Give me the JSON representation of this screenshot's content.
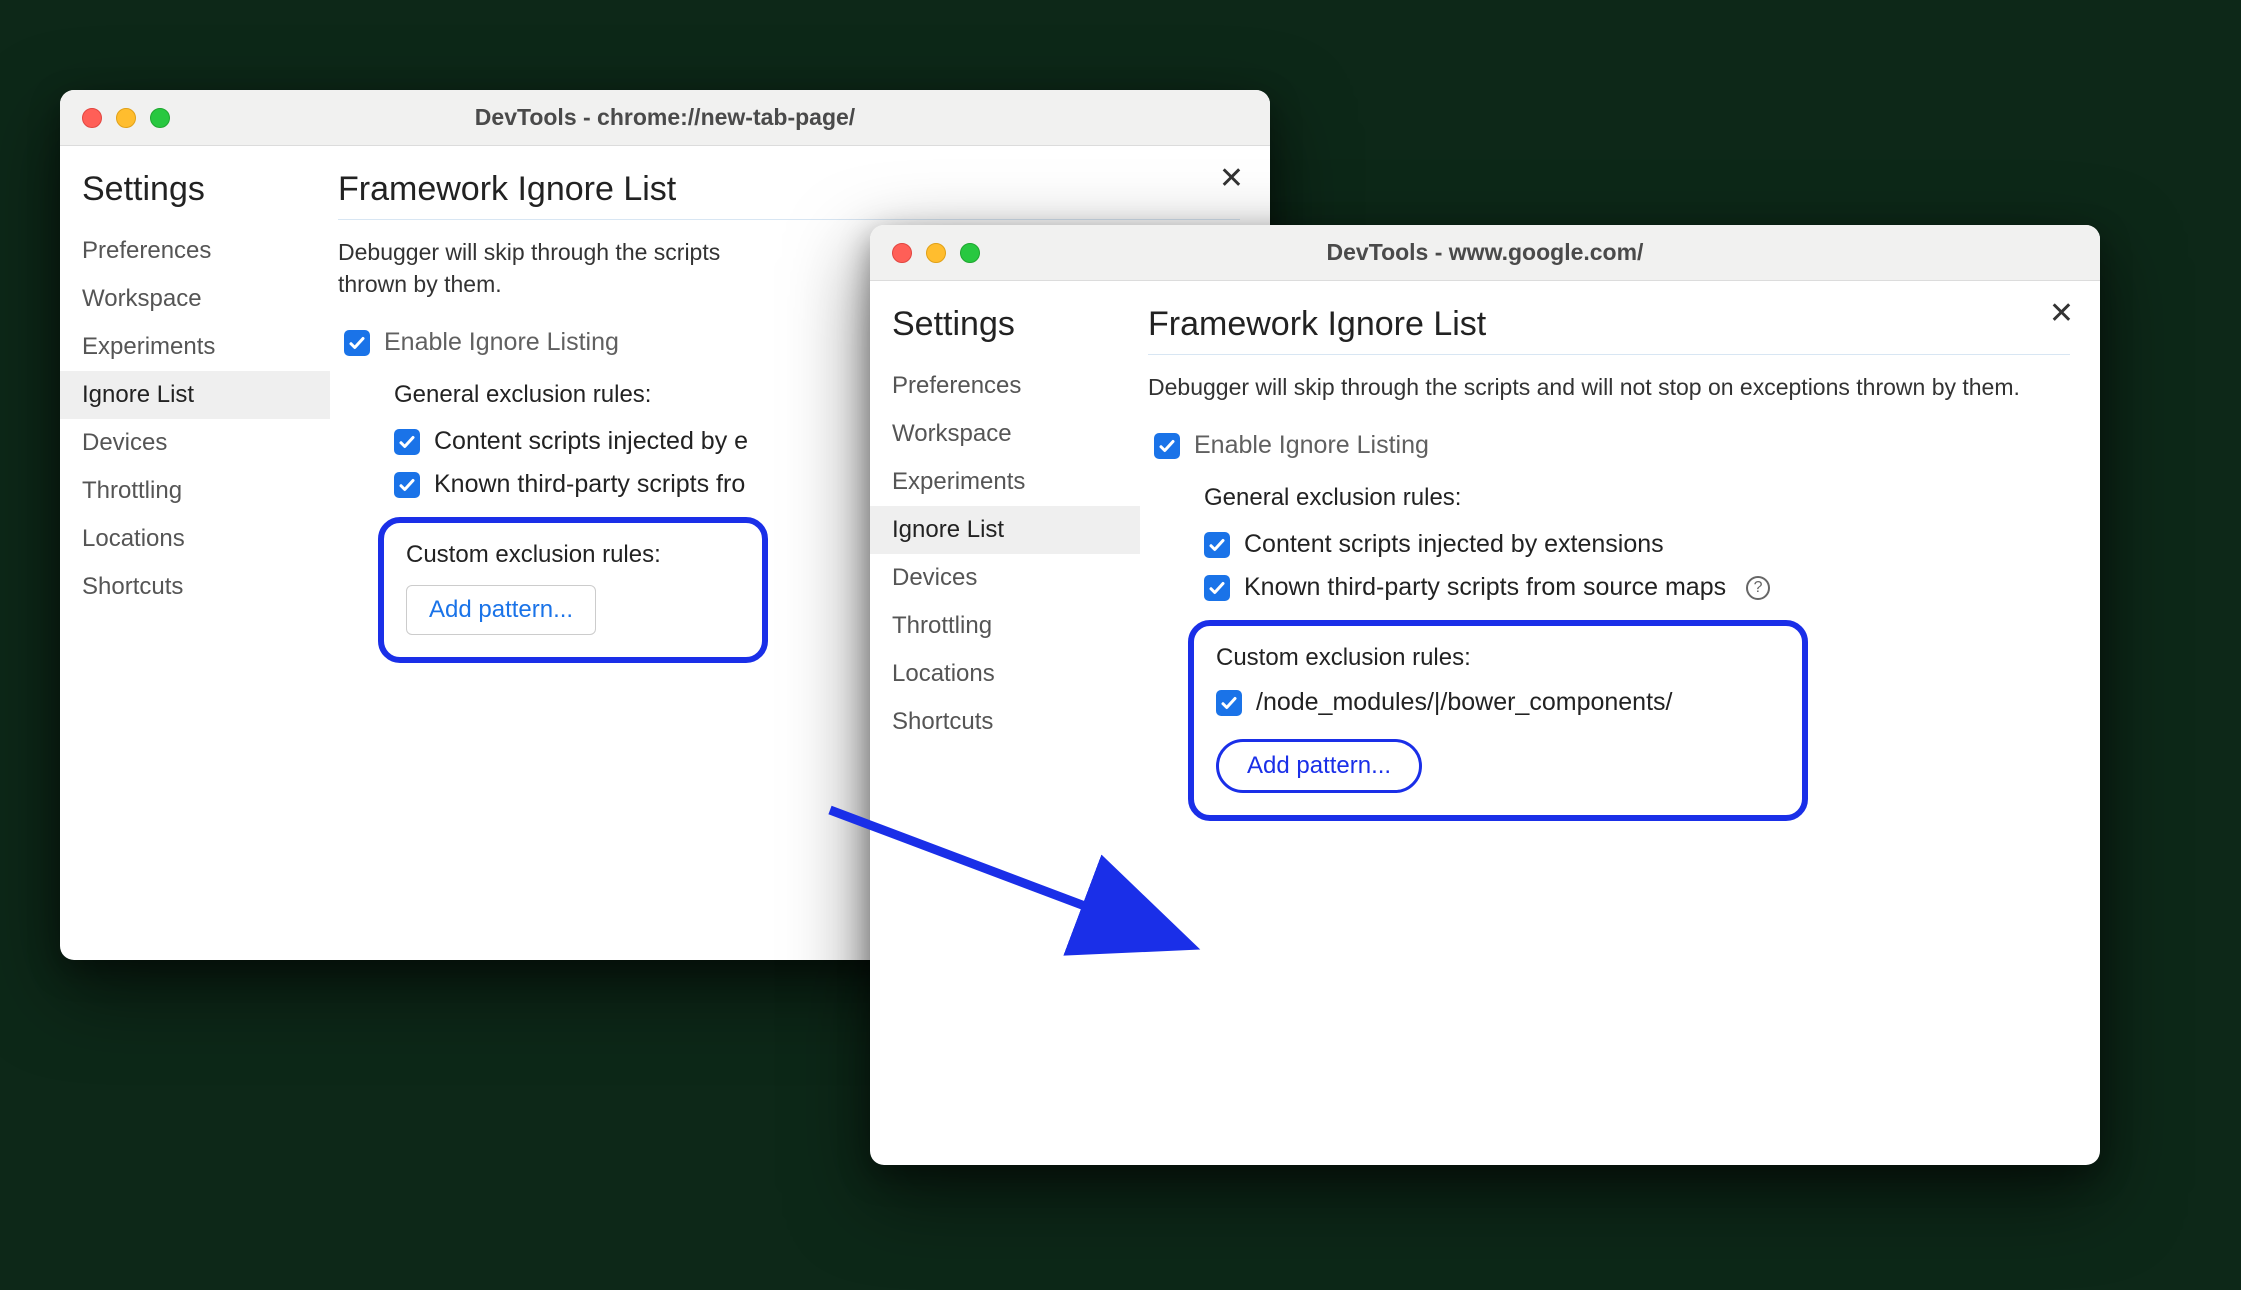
{
  "windows": {
    "left": {
      "title": "DevTools - chrome://new-tab-page/",
      "settings_title": "Settings",
      "nav": [
        "Preferences",
        "Workspace",
        "Experiments",
        "Ignore List",
        "Devices",
        "Throttling",
        "Locations",
        "Shortcuts"
      ],
      "nav_active_index": 3,
      "panel_title": "Framework Ignore List",
      "panel_desc_visible": "Debugger will skip through the scripts\nthrown by them.",
      "enable_label": "Enable Ignore Listing",
      "general_rules_head": "General exclusion rules:",
      "rule_content_visible": "Content scripts injected by e",
      "rule_thirdparty_visible": "Known third-party scripts fro",
      "custom_head": "Custom exclusion rules:",
      "add_pattern": "Add pattern..."
    },
    "right": {
      "title": "DevTools - www.google.com/",
      "settings_title": "Settings",
      "nav": [
        "Preferences",
        "Workspace",
        "Experiments",
        "Ignore List",
        "Devices",
        "Throttling",
        "Locations",
        "Shortcuts"
      ],
      "nav_active_index": 3,
      "panel_title": "Framework Ignore List",
      "panel_desc": "Debugger will skip through the scripts and will not stop on exceptions thrown by them.",
      "enable_label": "Enable Ignore Listing",
      "general_rules_head": "General exclusion rules:",
      "rule_content": "Content scripts injected by extensions",
      "rule_thirdparty": "Known third-party scripts from source maps",
      "custom_head": "Custom exclusion rules:",
      "custom_pattern": "/node_modules/|/bower_components/",
      "add_pattern": "Add pattern..."
    }
  }
}
